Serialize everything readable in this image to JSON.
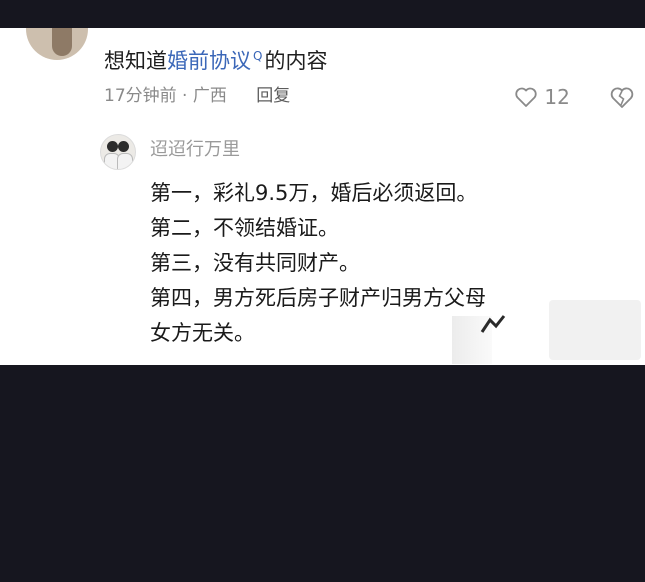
{
  "comment": {
    "prefix": "想知道",
    "link": "婚前协议",
    "search_mark": "Q",
    "suffix": "的内容"
  },
  "meta": {
    "time": "17分钟前",
    "sep": "·",
    "location": "广西",
    "reply_label": "回复"
  },
  "like": {
    "count": "12",
    "icon": "heart-icon"
  },
  "dislike": {
    "icon": "broken-heart-icon"
  },
  "reply": {
    "author": "迢迢行万里",
    "lines": [
      "第一，彩礼9.5万，婚后必须返回。",
      "第二，不领结婚证。",
      "第三，没有共同财产。",
      "第四，男方死后房子财产归男方父母",
      "女方无关。"
    ]
  }
}
